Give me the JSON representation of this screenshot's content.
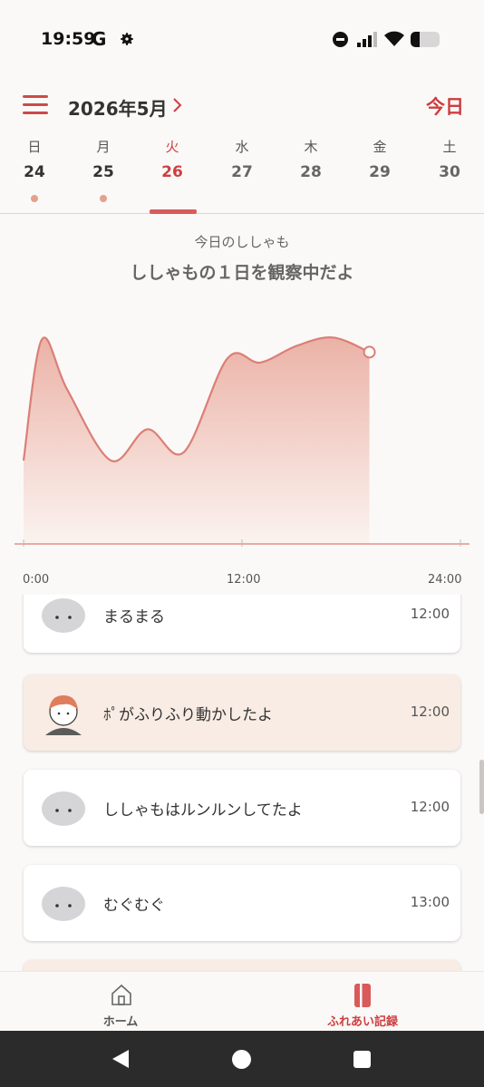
{
  "status_bar": {
    "time": "19:59",
    "google_badge": "G",
    "icons": [
      "gear-icon",
      "do-not-disturb-icon",
      "signal-icon",
      "wifi-icon",
      "battery-icon"
    ],
    "battery_fraction": 0.3
  },
  "header": {
    "month_label": "2026年5月",
    "today_label": "今日"
  },
  "week": {
    "days": [
      {
        "dow": "日",
        "num": "24",
        "has_record": true
      },
      {
        "dow": "月",
        "num": "25",
        "has_record": true
      },
      {
        "dow": "火",
        "num": "26",
        "has_record": false,
        "selected": true
      },
      {
        "dow": "水",
        "num": "27",
        "has_record": false
      },
      {
        "dow": "木",
        "num": "28",
        "has_record": false
      },
      {
        "dow": "金",
        "num": "29",
        "has_record": false
      },
      {
        "dow": "土",
        "num": "30",
        "has_record": false
      }
    ]
  },
  "chart": {
    "subtitle": "今日のししゃも",
    "title": "ししゃもの１日を観察中だよ"
  },
  "chart_data": {
    "type": "area",
    "x_unit": "hours",
    "xlim": [
      0,
      24
    ],
    "x_ticks": [
      "0:00",
      "12:00",
      "24:00"
    ],
    "x_tick_values": [
      0,
      12,
      24
    ],
    "ylim": [
      0,
      100
    ],
    "y_axis_labels": false,
    "grid": false,
    "points": [
      {
        "x": 0,
        "y": 40
      },
      {
        "x": 1,
        "y": 98
      },
      {
        "x": 2.4,
        "y": 74
      },
      {
        "x": 4.8,
        "y": 40
      },
      {
        "x": 6.8,
        "y": 55
      },
      {
        "x": 8.8,
        "y": 44
      },
      {
        "x": 11.2,
        "y": 89
      },
      {
        "x": 13,
        "y": 87
      },
      {
        "x": 15,
        "y": 95
      },
      {
        "x": 17,
        "y": 99
      },
      {
        "x": 19,
        "y": 92
      }
    ],
    "current_point_x": 19,
    "line_color": "#db7f76",
    "fill_top_color": "#eaaea2",
    "fill_bottom_color": "#fbf2ee"
  },
  "records": [
    {
      "avatar": "shishamo-avatar",
      "text": "まるまる",
      "time": "12:00",
      "is_user": false
    },
    {
      "avatar": "user-avatar",
      "text": "ﾎﾟがふりふり動かしたよ",
      "time": "12:00",
      "is_user": true
    },
    {
      "avatar": "shishamo-avatar",
      "text": "ししゃもはルンルンしてたよ",
      "time": "12:00",
      "is_user": false
    },
    {
      "avatar": "shishamo-avatar",
      "text": "むぐむぐ",
      "time": "13:00",
      "is_user": false
    },
    {
      "avatar": "",
      "text": "",
      "time": "",
      "is_user": true
    }
  ],
  "bottom_nav": {
    "home_label": "ホーム",
    "records_label": "ふれあい記録",
    "active": "records"
  },
  "colors": {
    "accent": "#cc3f3f",
    "background": "#fbf9f8",
    "user_card": "#f8ece4",
    "record_dot": "#e3a18e"
  }
}
